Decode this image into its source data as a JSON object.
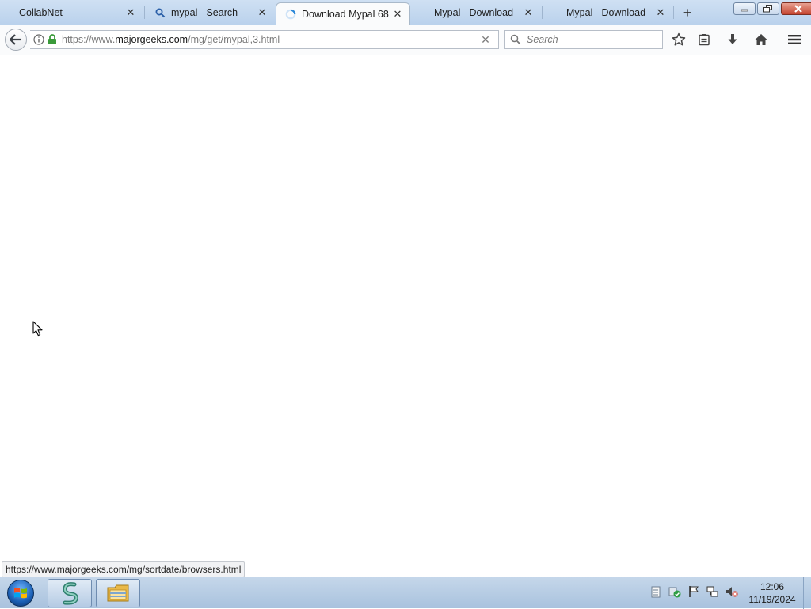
{
  "browser": {
    "tabs": [
      {
        "title": "CollabNet",
        "icon": "page-icon",
        "active": false
      },
      {
        "title": "mypal - Search",
        "icon": "search-icon",
        "active": false
      },
      {
        "title": "Download Mypal 68",
        "icon": "loading-spinner-icon",
        "active": true
      },
      {
        "title": "Mypal - Download",
        "icon": "none",
        "active": false
      },
      {
        "title": "Mypal - Download",
        "icon": "none",
        "active": false
      }
    ],
    "new_tab_symbol": "+",
    "url": {
      "scheme": "https://www.",
      "host": "majorgeeks.com",
      "path": "/mg/get/mypal,3.html"
    },
    "search": {
      "placeholder": "Search",
      "value": ""
    },
    "toolbar_icons": [
      "star-icon",
      "reading-list-icon",
      "download-icon",
      "home-icon",
      "menu-icon"
    ]
  },
  "status_text": "https://www.majorgeeks.com/mg/sortdate/browsers.html",
  "taskbar": {
    "apps": [
      "serpent-app-icon",
      "file-explorer-icon"
    ],
    "tray_icons": [
      "notes-icon",
      "security-shield-icon",
      "action-center-flag-icon",
      "network-icon",
      "volume-muted-icon"
    ],
    "clock": {
      "time": "12:06",
      "date": "11/19/2024"
    }
  },
  "colors": {
    "tabstrip_top": "#cfe0f3",
    "tabstrip_bottom": "#b9d1ec",
    "taskbar": "#b3c9e2",
    "lock_green": "#3a9a3a"
  }
}
